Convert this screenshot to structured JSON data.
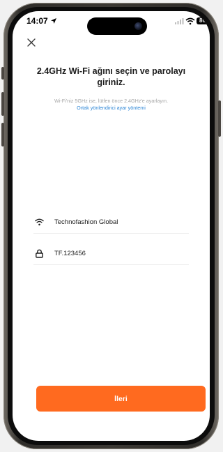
{
  "status_bar": {
    "time": "14:07",
    "battery_level": "80"
  },
  "header": {
    "close_icon": "close-icon"
  },
  "main": {
    "title": "2.4GHz Wi-Fi ağını seçin ve parolayı giriniz.",
    "subtitle": "Wi-Fi'niz 5GHz ise, lütfen önce 2.4GHz'e ayarlayın.",
    "router_link": "Ortak yönlendirici ayar yöntemi"
  },
  "form": {
    "ssid": {
      "value": "Technofashion Global",
      "icon": "wifi-icon",
      "action_icon": "switch-network-icon"
    },
    "password": {
      "value": "TF.123456",
      "icon": "lock-icon",
      "action_icon": "eye-icon"
    }
  },
  "footer": {
    "next_label": "İleri"
  },
  "colors": {
    "accent": "#ff6a1f",
    "link": "#2d86d6",
    "text": "#1c1c1c",
    "hint": "#a6a6a6"
  }
}
